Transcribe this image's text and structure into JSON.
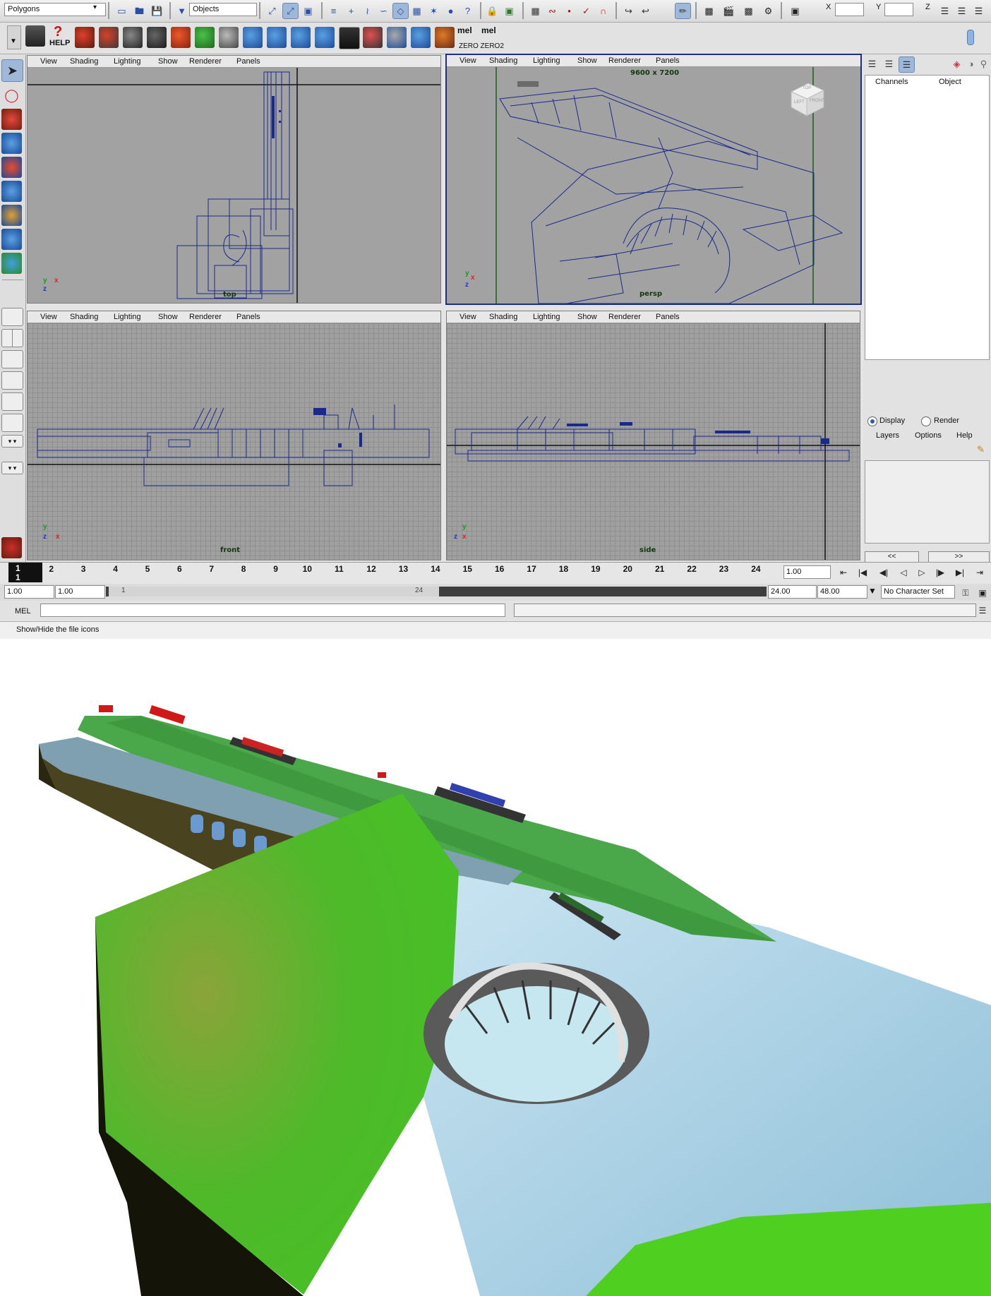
{
  "status_line": {
    "mode": "Polygons",
    "selection_mask": "Objects",
    "x_label": "X",
    "y_label": "Y",
    "z_label": "Z"
  },
  "shelf": {
    "help_label": "HELP",
    "mel1": "mel",
    "mel2": "mel",
    "mel_caption": "ZERO ZERO2"
  },
  "viewport_menu": [
    "View",
    "Shading",
    "Lighting",
    "Show",
    "Renderer",
    "Panels"
  ],
  "viewports": {
    "top": {
      "camera": "top"
    },
    "persp": {
      "camera": "persp",
      "resolution": "9600 x 7200",
      "cube_top": "TOP",
      "cube_left": "LEFT",
      "cube_front": "FRONT"
    },
    "front": {
      "camera": "front"
    },
    "side": {
      "camera": "side"
    }
  },
  "axes": {
    "x": "x",
    "y": "y",
    "z": "z"
  },
  "channel_box": {
    "tabs": [
      "Channels",
      "Object"
    ]
  },
  "layer_editor": {
    "display_label": "Display",
    "render_label": "Render",
    "menu": [
      "Layers",
      "Options",
      "Help"
    ],
    "prev": "<<",
    "next": ">>"
  },
  "time_slider": {
    "ticks": [
      "1",
      "2",
      "3",
      "4",
      "5",
      "6",
      "7",
      "8",
      "9",
      "10",
      "11",
      "12",
      "13",
      "14",
      "15",
      "16",
      "17",
      "18",
      "19",
      "20",
      "21",
      "22",
      "23",
      "24"
    ],
    "current_frame": "1",
    "current_frame_sub": "1",
    "current_time_field": "1.00"
  },
  "range_slider": {
    "start_time": "1.00",
    "playback_start": "1.00",
    "range_left": "1",
    "range_right": "24",
    "playback_end": "24.00",
    "end_time": "48.00",
    "character_set": "No Character Set"
  },
  "command_line": {
    "label": "MEL"
  },
  "help_line": {
    "text": "Show/Hide the file icons"
  },
  "render": {
    "water_color": "#a9d2e6",
    "grass_color": "#59c22c",
    "cliff_color": "#1a1a0a"
  }
}
